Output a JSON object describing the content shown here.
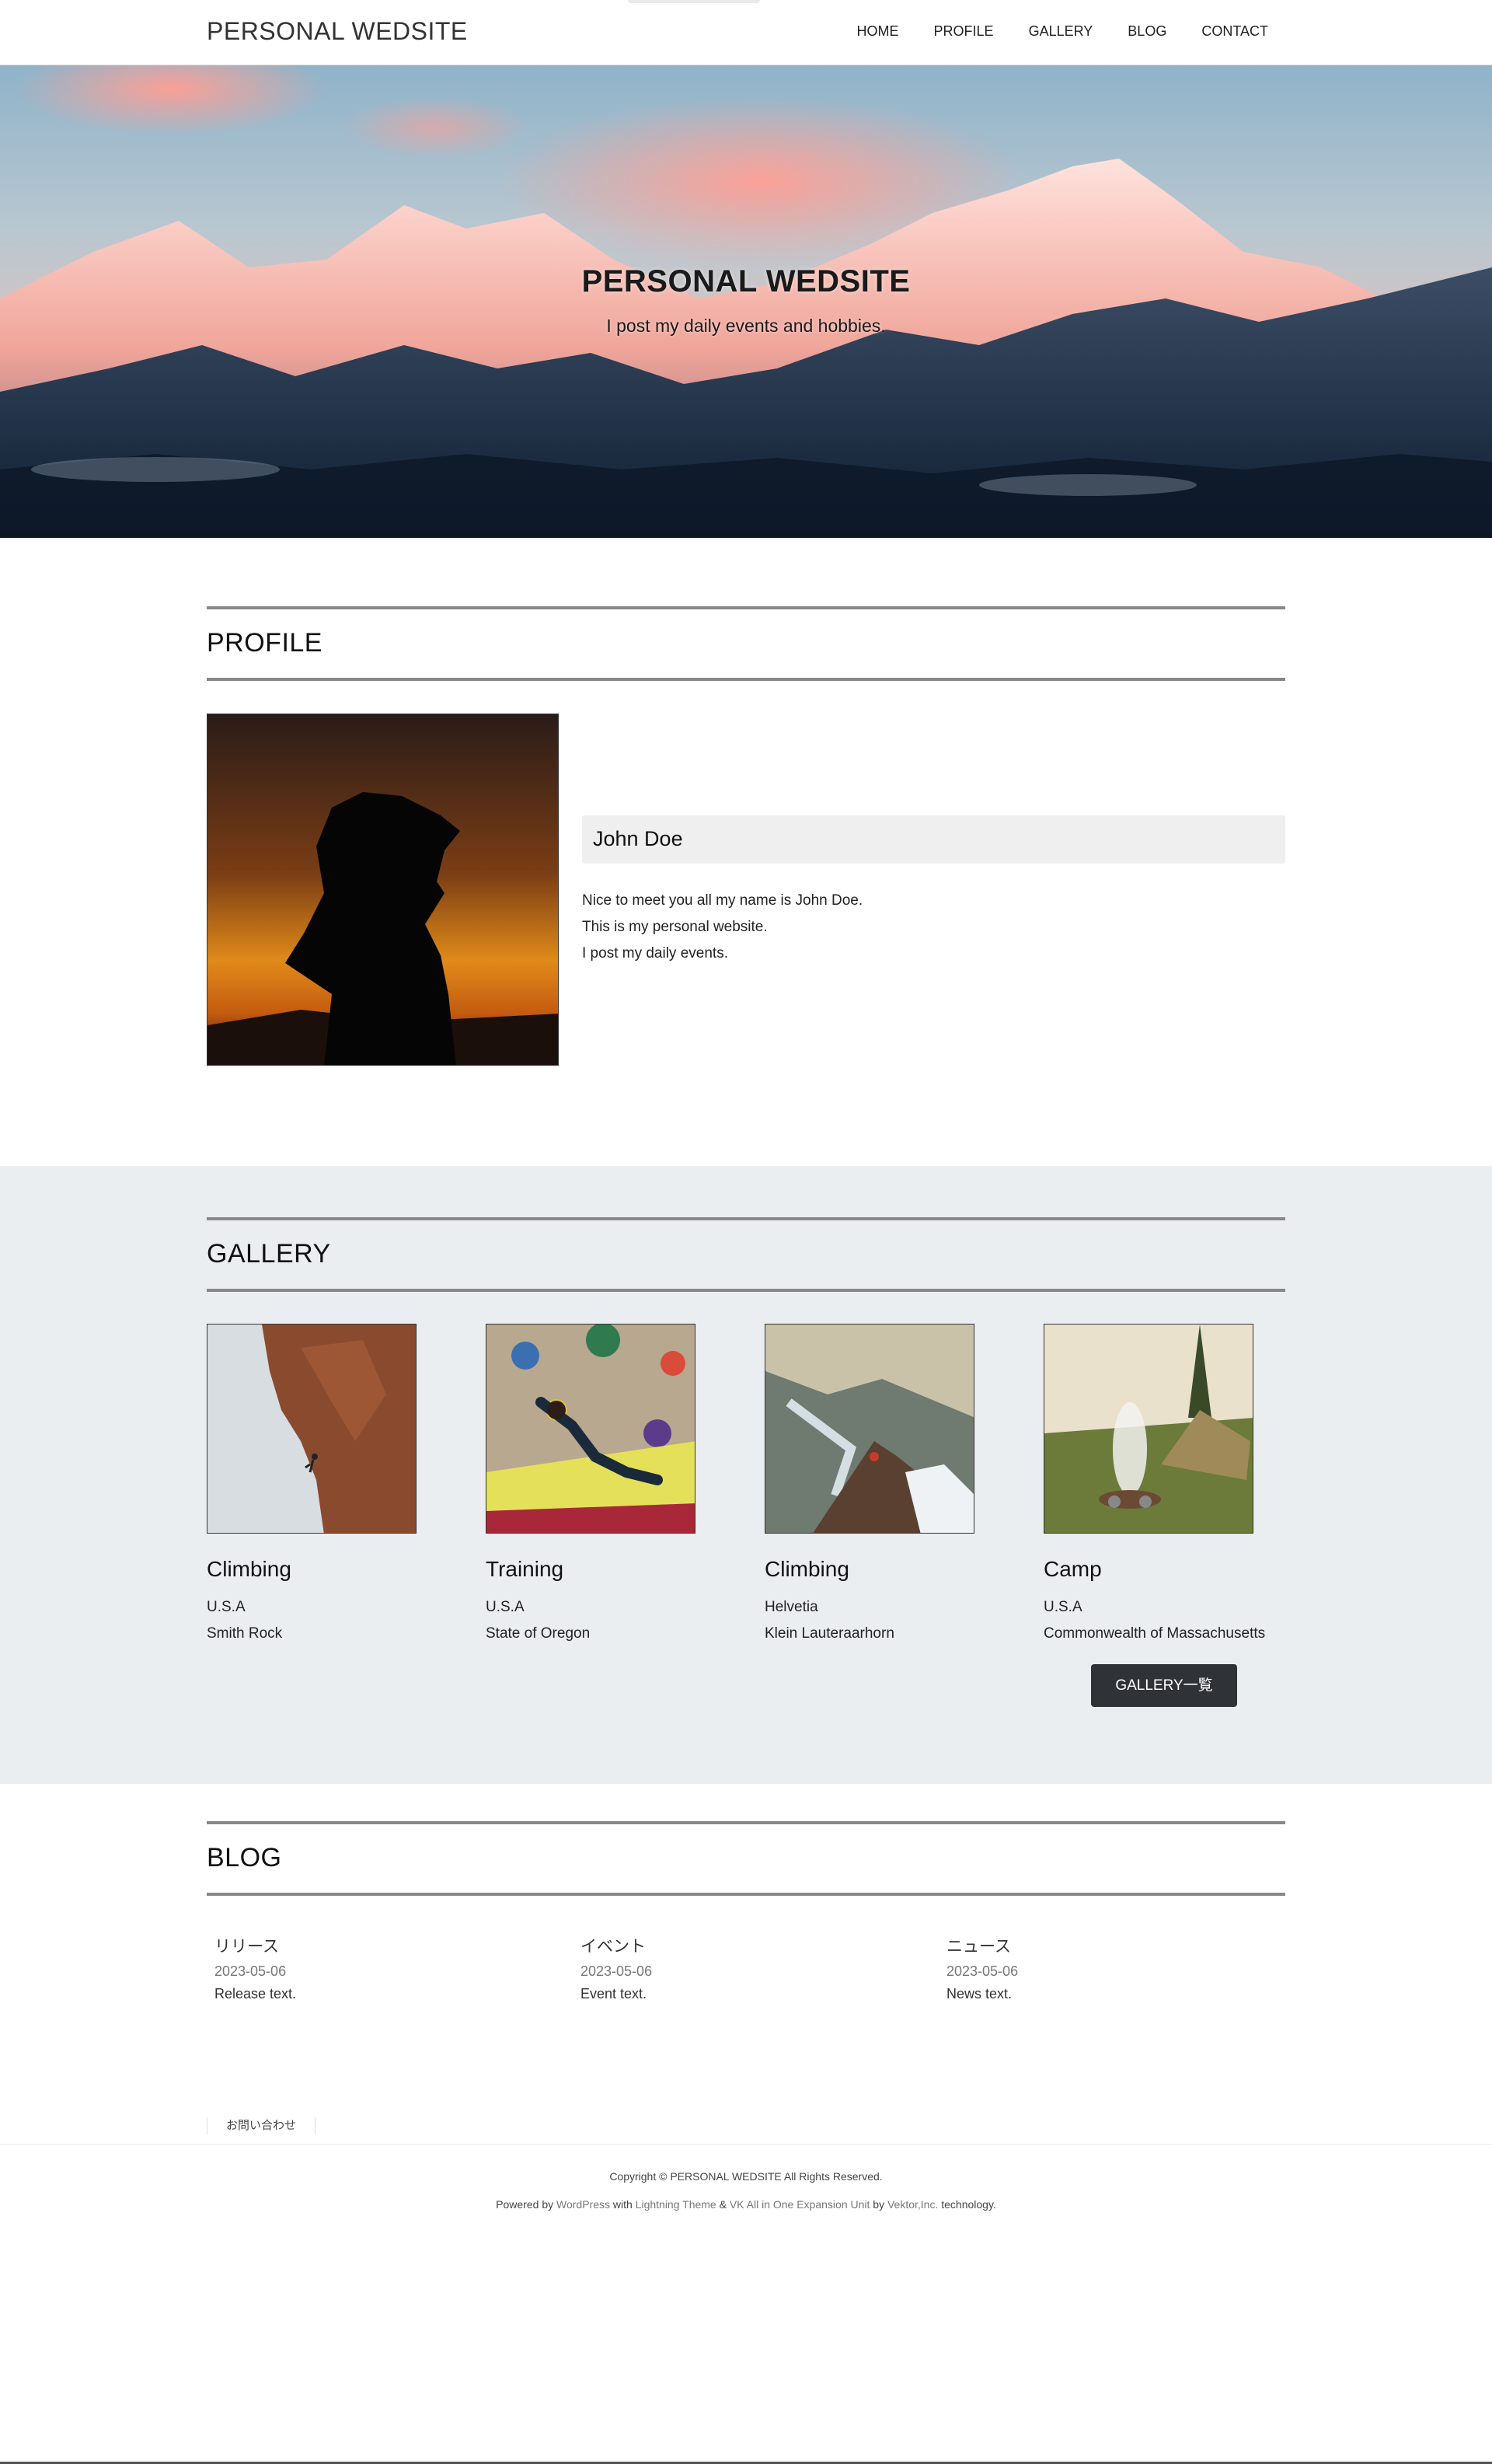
{
  "header": {
    "logo": "PERSONAL WEDSITE",
    "nav": [
      "HOME",
      "PROFILE",
      "GALLERY",
      "BLOG",
      "CONTACT"
    ]
  },
  "hero": {
    "title": "PERSONAL WEDSITE",
    "subtitle": "I post my daily events and hobbies."
  },
  "profile": {
    "heading": "PROFILE",
    "name": "John Doe",
    "lines": [
      "Nice to meet you all my name is John Doe.",
      "This is my personal website.",
      "I post my daily events."
    ]
  },
  "gallery": {
    "heading": "GALLERY",
    "items": [
      {
        "title": "Climbing",
        "line1": "U.S.A",
        "line2": "Smith Rock"
      },
      {
        "title": "Training",
        "line1": "U.S.A",
        "line2": "State of Oregon"
      },
      {
        "title": "Climbing",
        "line1": "Helvetia",
        "line2": "Klein Lauteraarhorn"
      },
      {
        "title": "Camp",
        "line1": "U.S.A",
        "line2": "Commonwealth of Massachusetts"
      }
    ],
    "button": "GALLERY一覧"
  },
  "blog": {
    "heading": "BLOG",
    "items": [
      {
        "category": "リリース",
        "date": "2023-05-06",
        "text": "Release text."
      },
      {
        "category": "イベント",
        "date": "2023-05-06",
        "text": "Event text."
      },
      {
        "category": "ニュース",
        "date": "2023-05-06",
        "text": "News text."
      }
    ]
  },
  "footer": {
    "nav_item": "お問い合わせ",
    "copyright": "Copyright © PERSONAL WEDSITE All Rights Reserved.",
    "powered_prefix": "Powered by",
    "wordpress": "WordPress",
    "with": "with",
    "lightning": "Lightning Theme",
    "amp": "&",
    "vk": "VK All in One Expansion Unit",
    "by": "by",
    "vektor": "Vektor,Inc.",
    "technology": "technology."
  },
  "colors": {
    "gallery_bg": "#ebeef1",
    "button_bg": "#2f3338",
    "heading_rule": "#888888"
  }
}
